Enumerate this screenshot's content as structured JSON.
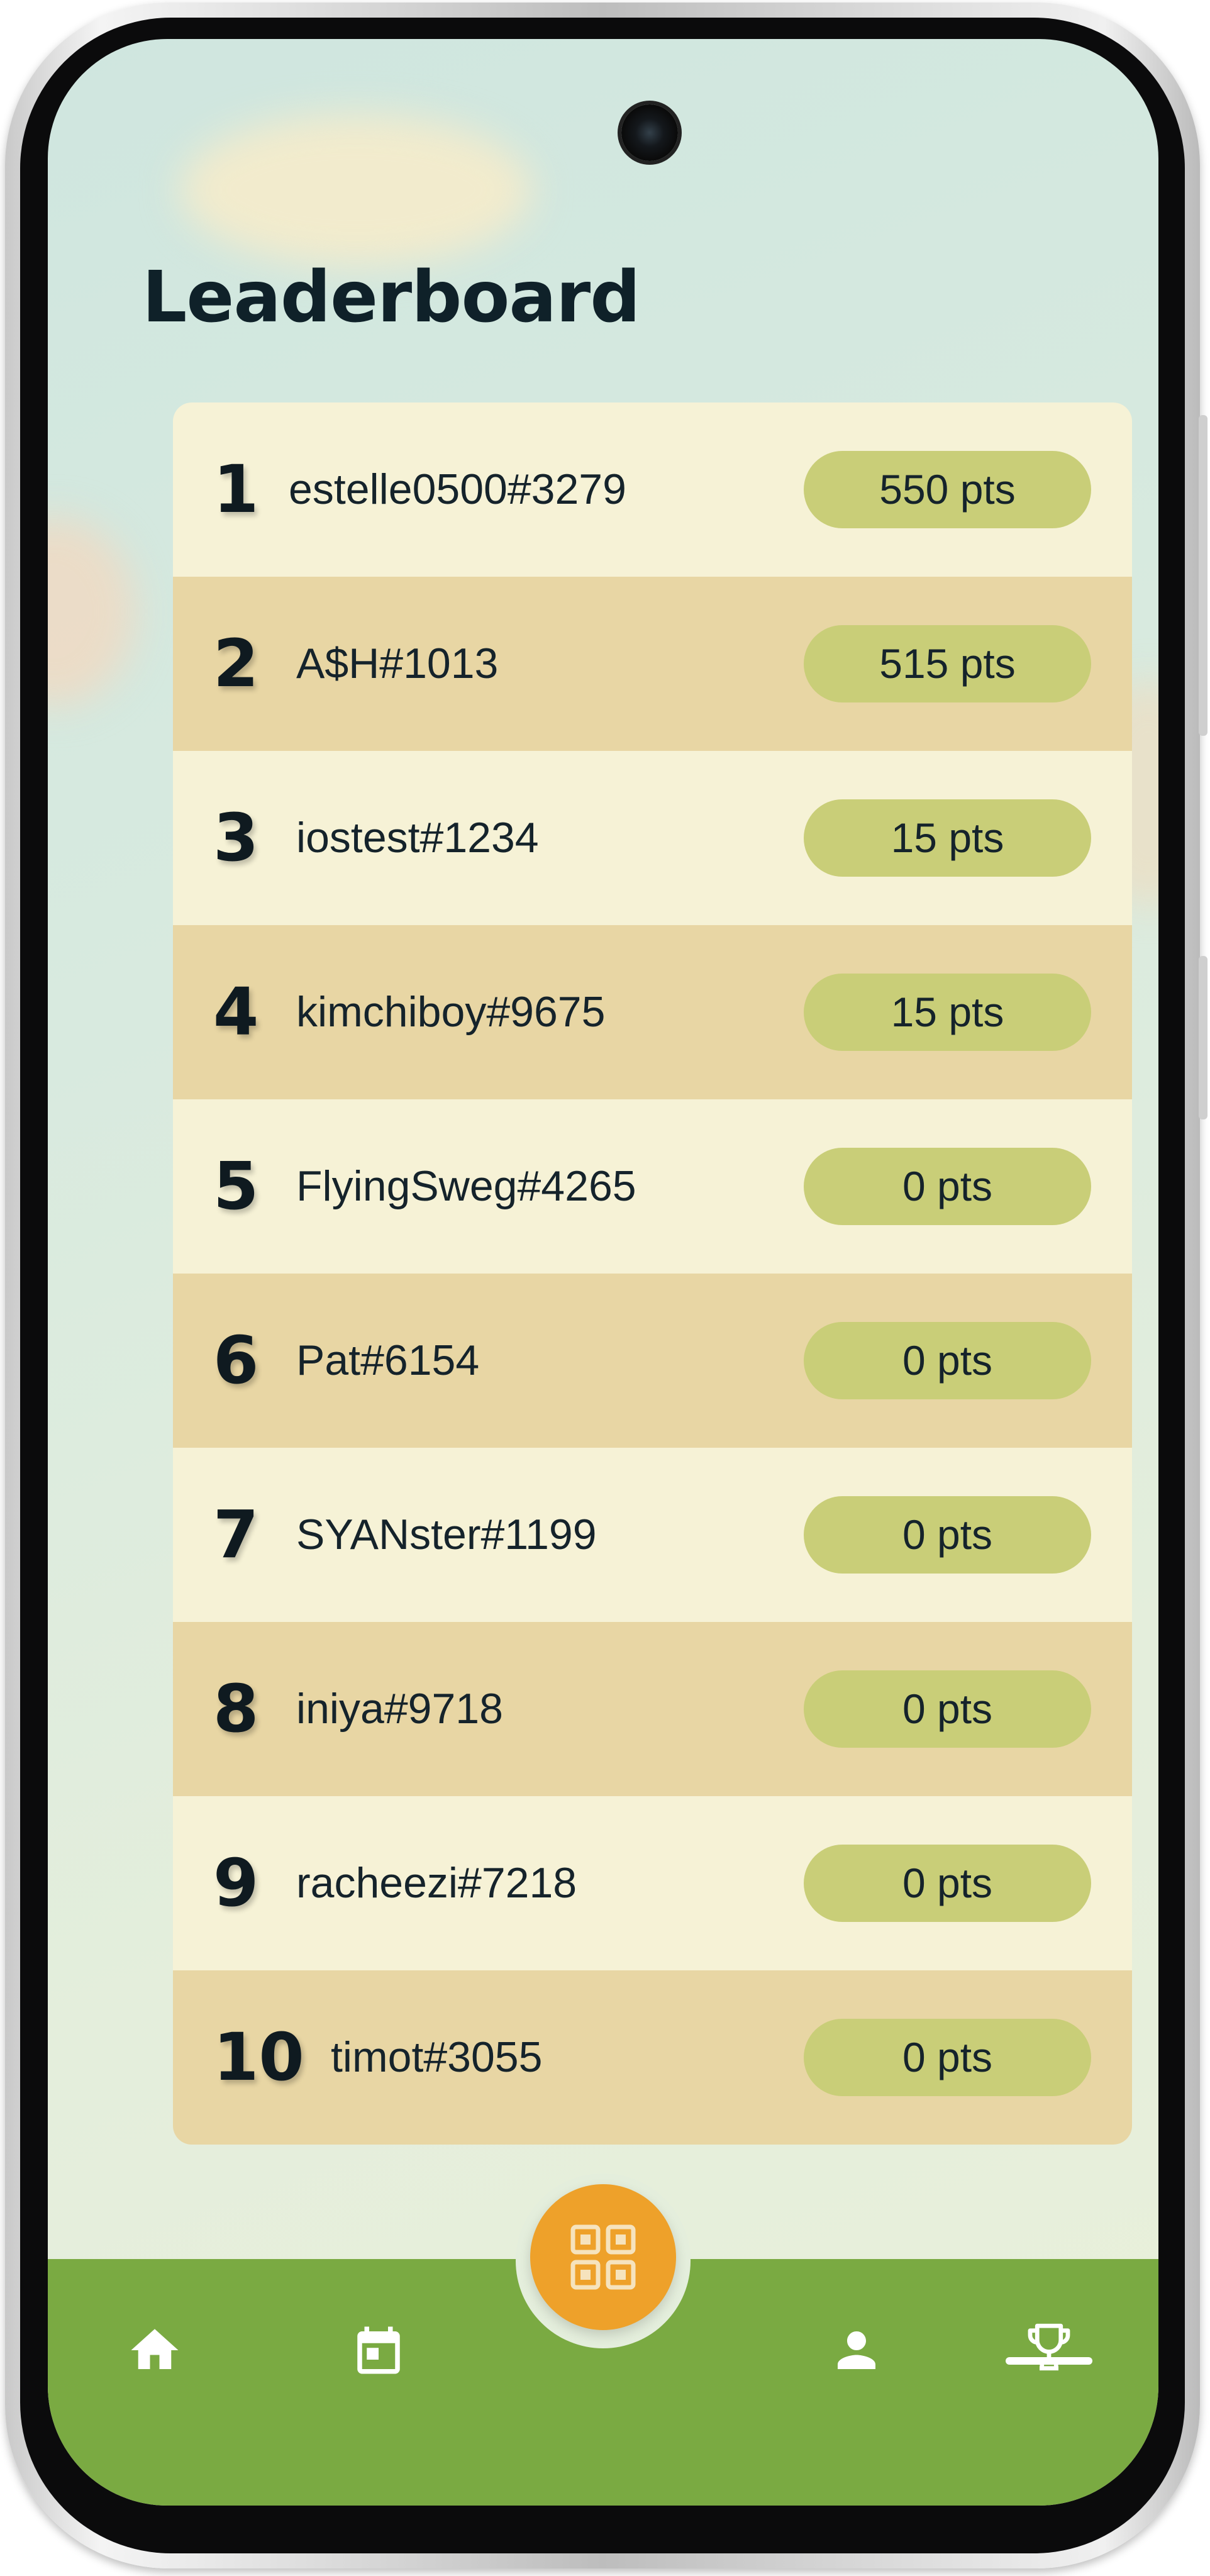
{
  "page": {
    "title": "Leaderboard"
  },
  "leaderboard": [
    {
      "rank": "1",
      "username": "estelle0500#3279",
      "points": "550 pts"
    },
    {
      "rank": "2",
      "username": "A$H#1013",
      "points": "515 pts"
    },
    {
      "rank": "3",
      "username": "iostest#1234",
      "points": "15 pts"
    },
    {
      "rank": "4",
      "username": "kimchiboy#9675",
      "points": "15 pts"
    },
    {
      "rank": "5",
      "username": "FlyingSweg#4265",
      "points": "0 pts"
    },
    {
      "rank": "6",
      "username": "Pat#6154",
      "points": "0 pts"
    },
    {
      "rank": "7",
      "username": "SYANster#1199",
      "points": "0 pts"
    },
    {
      "rank": "8",
      "username": "iniya#9718",
      "points": "0 pts"
    },
    {
      "rank": "9",
      "username": "racheezi#7218",
      "points": "0 pts"
    },
    {
      "rank": "10",
      "username": "timot#3055",
      "points": "0 pts"
    }
  ],
  "nav": {
    "items": [
      "home-icon",
      "calendar-icon",
      "qr-code-icon",
      "person-icon",
      "trophy-icon"
    ],
    "active": "trophy-icon"
  },
  "colors": {
    "row_light": "#f6f2d6",
    "row_dark": "#e8d6a4",
    "points_pill": "#c9ce78",
    "nav_bar": "#7aaa42",
    "fab": "#eea12a",
    "title_text": "#0f2129"
  }
}
